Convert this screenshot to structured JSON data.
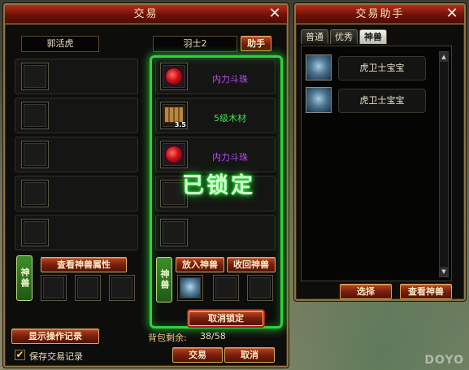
{
  "trade_window": {
    "title": "交易",
    "left_player": {
      "name": "郭活虎",
      "pet_tab_label": "神兽",
      "view_pet_attr_button": "查看神兽属性"
    },
    "right_player": {
      "name": "羽士2",
      "helper_button": "助手",
      "items": [
        {
          "name": "内力斗珠",
          "color": "#b84cf2",
          "icon": "red-orb-icon"
        },
        {
          "name": "5级木材",
          "color": "#43e05a",
          "icon": "wood-material-icon",
          "badge": "3.5"
        },
        {
          "name": "内力斗珠",
          "color": "#b84cf2",
          "icon": "red-orb-icon"
        }
      ],
      "locked_label": "已锁定",
      "pet_tab_label": "神兽",
      "place_pet_button": "放入神兽",
      "retrieve_pet_button": "收回神兽",
      "cancel_lock_button": "取消锁定"
    },
    "show_log_button": "显示操作记录",
    "bag_remaining_label": "背包剩余:",
    "bag_remaining_value": "38/58",
    "save_record_label": "保存交易记录",
    "save_record_checked": true,
    "trade_button": "交易",
    "cancel_button": "取消"
  },
  "helper_window": {
    "title": "交易助手",
    "tabs": [
      {
        "label": "普通",
        "active": false
      },
      {
        "label": "优秀",
        "active": false
      },
      {
        "label": "神兽",
        "active": true
      }
    ],
    "pets": [
      {
        "name": "虎卫士宝宝",
        "icon": "tiger-guard-pet-icon"
      },
      {
        "name": "虎卫士宝宝",
        "icon": "tiger-guard-pet-icon"
      }
    ],
    "select_button": "选择",
    "view_pet_button": "查看神兽"
  },
  "watermark": "DOYO",
  "colors": {
    "title_red": "#8a1a0c",
    "frame_gold": "#8e7545",
    "lock_green": "#2dd43c",
    "item_purple": "#b84cf2",
    "item_green": "#43e05a"
  }
}
